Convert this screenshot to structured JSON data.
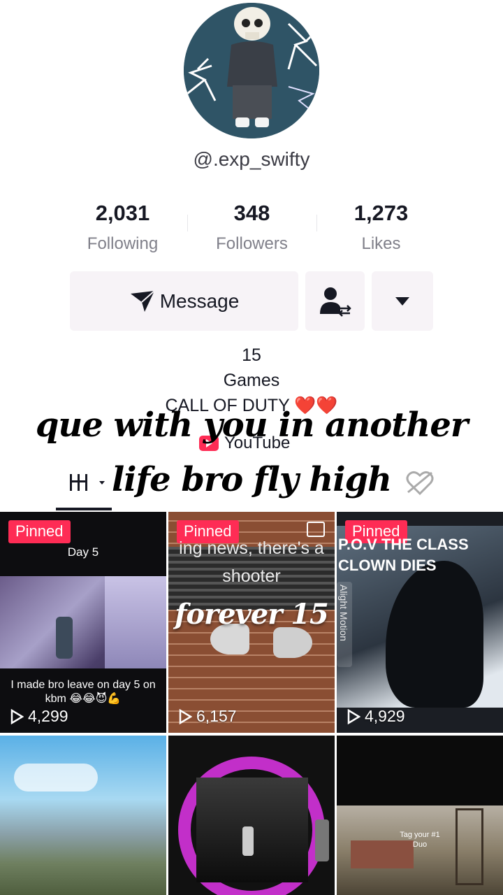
{
  "profile": {
    "username": "@.exp_swifty",
    "stats": [
      {
        "value": "2,031",
        "label": "Following"
      },
      {
        "value": "348",
        "label": "Followers"
      },
      {
        "value": "1,273",
        "label": "Likes"
      }
    ],
    "message_label": "Message",
    "bio": {
      "line1": "15",
      "line2": "Games",
      "line3": "CALL OF DUTY ❤️❤️",
      "link": "YouTube"
    }
  },
  "overlay_text": {
    "line1": "que with you in another",
    "line2": "life bro fly high",
    "line3": "forever 15"
  },
  "videos": [
    {
      "pinned": "Pinned",
      "top_caption": "Day 5",
      "bottom_caption": "I made bro leave on day 5 on kbm 😂😂😈💪",
      "views": "4,299"
    },
    {
      "pinned": "Pinned",
      "top_caption": "ing news, there's a",
      "top_caption2": "shooter",
      "views": "6,157"
    },
    {
      "pinned": "Pinned",
      "top_caption": "P.O.V  THE CLASS",
      "top_caption2": "CLOWN DIES",
      "side_label": "Alight Motion",
      "views": "4,929"
    },
    {
      "views": ""
    },
    {
      "views": ""
    },
    {
      "overlay_caption": "Tag your #1",
      "overlay_caption2": "Duo",
      "views": ""
    }
  ],
  "colors": {
    "accent": "#fe2c55",
    "button_bg": "#f7f3f7",
    "text_secondary": "#80808a"
  }
}
